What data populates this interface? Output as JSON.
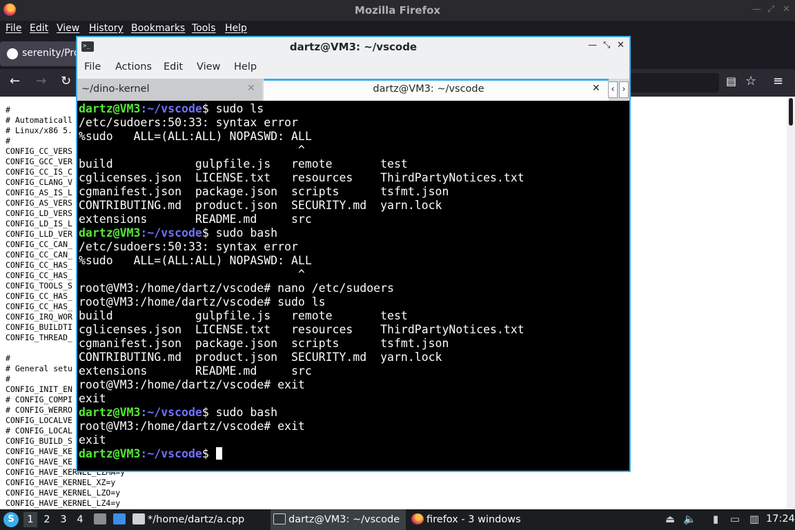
{
  "firefox": {
    "window_title": "Mozilla Firefox",
    "menu": [
      "File",
      "Edit",
      "View",
      "History",
      "Bookmarks",
      "Tools",
      "Help"
    ],
    "tab_title": "serenity/Pro",
    "config_lines": [
      "#",
      "# Automaticall",
      "# Linux/x86 5.",
      "#",
      "CONFIG_CC_VERS",
      "CONFIG_GCC_VER",
      "CONFIG_CC_IS_C",
      "CONFIG_CLANG_V",
      "CONFIG_AS_IS_L",
      "CONFIG_AS_VERS",
      "CONFIG_LD_VERS",
      "CONFIG_LD_IS_L",
      "CONFIG_LLD_VER",
      "CONFIG_CC_CAN_",
      "CONFIG_CC_CAN_",
      "CONFIG_CC_HAS_",
      "CONFIG_CC_HAS_",
      "CONFIG_TOOLS_S",
      "CONFIG_CC_HAS_",
      "CONFIG_CC_HAS_",
      "CONFIG_IRQ_WOR",
      "CONFIG_BUILDTI",
      "CONFIG_THREAD_",
      "",
      "#",
      "# General setu",
      "#",
      "CONFIG_INIT_EN",
      "# CONFIG_COMPI",
      "# CONFIG_WERRO",
      "CONFIG_LOCALVE",
      "# CONFIG_LOCAL",
      "CONFIG_BUILD_S",
      "CONFIG_HAVE_KE",
      "CONFIG_HAVE_KE",
      "CONFIG_HAVE_KERNEL_LZMA=y",
      "CONFIG_HAVE_KERNEL_XZ=y",
      "CONFIG_HAVE_KERNEL_LZO=y",
      "CONFIG_HAVE_KERNEL_LZ4=y"
    ]
  },
  "konsole": {
    "window_title": "dartz@VM3: ~/vscode",
    "menu": [
      "File",
      "Actions",
      "Edit",
      "View",
      "Help"
    ],
    "tabs": [
      {
        "label": "~/dino-kernel"
      },
      {
        "label": "dartz@VM3: ~/vscode"
      }
    ],
    "prompt_user": "dartz@VM3",
    "prompt_path": ":~/vscode",
    "root_prompt": "root@VM3:/home/dartz/vscode#",
    "lines": [
      {
        "kind": "prompt",
        "cmd": "$ sudo ls"
      },
      {
        "kind": "out",
        "text": "/etc/sudoers:50:33: syntax error"
      },
      {
        "kind": "out",
        "text": "%sudo   ALL=(ALL:ALL) NOPASWD: ALL"
      },
      {
        "kind": "out",
        "text": "                                ^"
      },
      {
        "kind": "out",
        "text": "build            gulpfile.js   remote       test"
      },
      {
        "kind": "out",
        "text": "cglicenses.json  LICENSE.txt   resources    ThirdPartyNotices.txt"
      },
      {
        "kind": "out",
        "text": "cgmanifest.json  package.json  scripts      tsfmt.json"
      },
      {
        "kind": "out",
        "text": "CONTRIBUTING.md  product.json  SECURITY.md  yarn.lock"
      },
      {
        "kind": "out",
        "text": "extensions       README.md     src"
      },
      {
        "kind": "prompt",
        "cmd": "$ sudo bash"
      },
      {
        "kind": "out",
        "text": "/etc/sudoers:50:33: syntax error"
      },
      {
        "kind": "out",
        "text": "%sudo   ALL=(ALL:ALL) NOPASWD: ALL"
      },
      {
        "kind": "out",
        "text": "                                ^"
      },
      {
        "kind": "out",
        "text": "root@VM3:/home/dartz/vscode# nano /etc/sudoers"
      },
      {
        "kind": "out",
        "text": "root@VM3:/home/dartz/vscode# sudo ls"
      },
      {
        "kind": "out",
        "text": "build            gulpfile.js   remote       test"
      },
      {
        "kind": "out",
        "text": "cglicenses.json  LICENSE.txt   resources    ThirdPartyNotices.txt"
      },
      {
        "kind": "out",
        "text": "cgmanifest.json  package.json  scripts      tsfmt.json"
      },
      {
        "kind": "out",
        "text": "CONTRIBUTING.md  product.json  SECURITY.md  yarn.lock"
      },
      {
        "kind": "out",
        "text": "extensions       README.md     src"
      },
      {
        "kind": "out",
        "text": "root@VM3:/home/dartz/vscode# exit"
      },
      {
        "kind": "out",
        "text": "exit"
      },
      {
        "kind": "prompt",
        "cmd": "$ sudo bash"
      },
      {
        "kind": "out",
        "text": "root@VM3:/home/dartz/vscode# exit"
      },
      {
        "kind": "out",
        "text": "exit"
      },
      {
        "kind": "prompt",
        "cmd": "$ "
      }
    ]
  },
  "taskbar": {
    "desktops": [
      "1",
      "2",
      "3",
      "4"
    ],
    "tasks": [
      {
        "label": "*/home/dartz/a.cpp",
        "icon": "text-editor-icon"
      },
      {
        "label": "dartz@VM3: ~/vscode",
        "icon": "terminal-icon"
      },
      {
        "label": "firefox - 3 windows",
        "icon": "firefox-icon"
      }
    ],
    "clock": "17:24"
  },
  "colors": {
    "accent": "#3daee9",
    "prompt_user": "#55e838",
    "prompt_path": "#7070ff"
  }
}
